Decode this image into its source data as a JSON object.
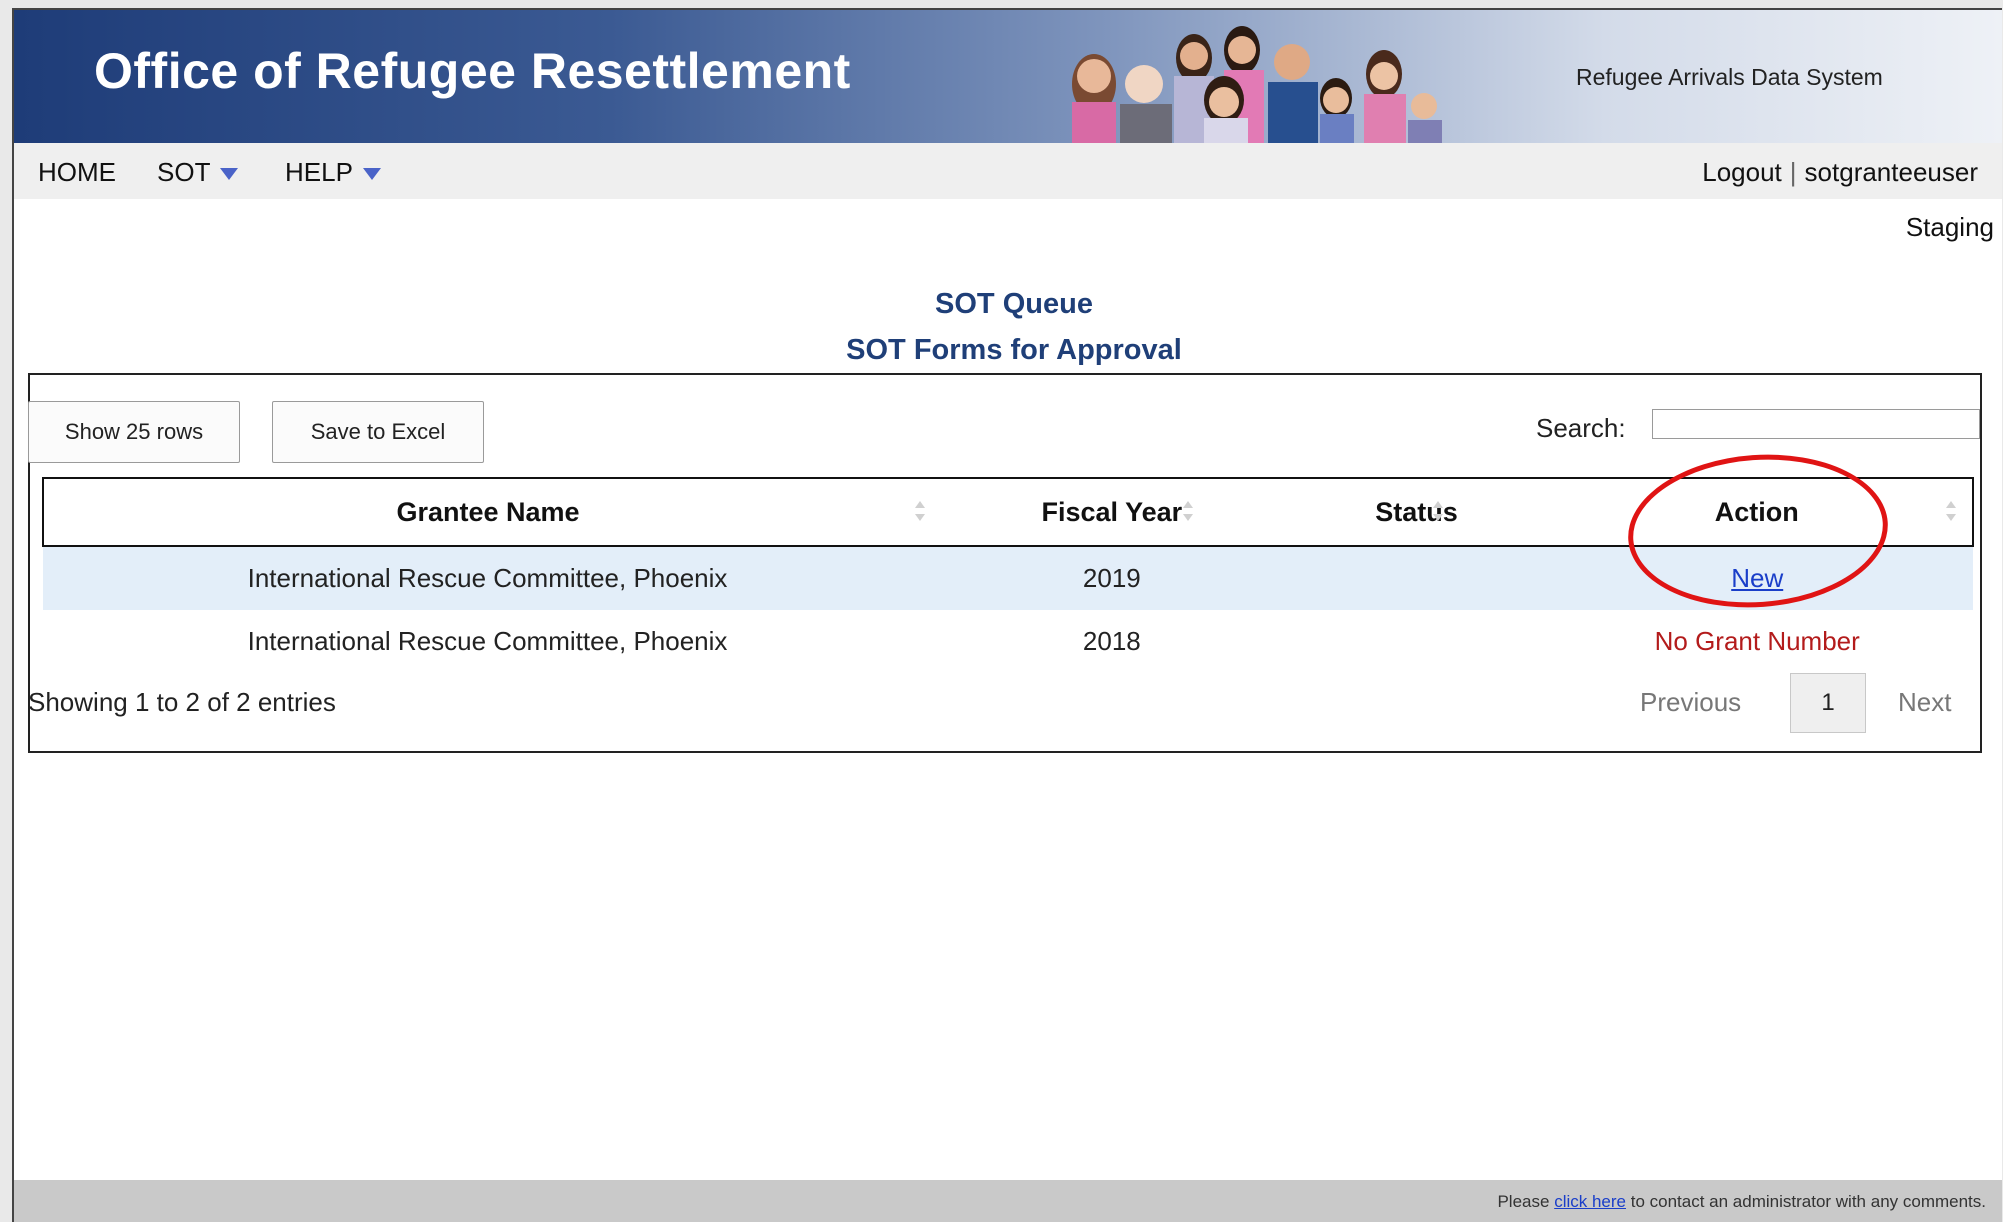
{
  "header": {
    "title": "Office of Refugee Resettlement",
    "system_name": "Refugee Arrivals Data System"
  },
  "nav": {
    "home": "HOME",
    "sot": "SOT",
    "help": "HELP",
    "logout": "Logout",
    "separator": "|",
    "username": "sotgranteeuser",
    "environment": "Staging"
  },
  "page": {
    "title": "SOT Queue",
    "subtitle": "SOT Forms for Approval"
  },
  "toolbar": {
    "show_rows_label": "Show 25 rows",
    "save_excel_label": "Save to Excel",
    "search_label": "Search:",
    "search_value": ""
  },
  "table": {
    "columns": [
      "Grantee Name",
      "Fiscal Year",
      "Status",
      "Action"
    ],
    "rows": [
      {
        "grantee": "International Rescue Committee, Phoenix",
        "fiscal_year": "2019",
        "status": "",
        "action": "New"
      },
      {
        "grantee": "International Rescue Committee, Phoenix",
        "fiscal_year": "2018",
        "status": "",
        "action": "No Grant Number"
      }
    ],
    "info": "Showing 1 to 2 of 2 entries",
    "pagination": {
      "previous": "Previous",
      "current": "1",
      "next": "Next"
    }
  },
  "footer": {
    "prefix": "Please",
    "link": "click here",
    "suffix": "to contact an administrator with any comments."
  },
  "colors": {
    "brand_dark": "#1e3c78",
    "heading": "#1f3f78",
    "link": "#1a3ec9",
    "error": "#b31b1b",
    "highlight": "#e01414"
  }
}
